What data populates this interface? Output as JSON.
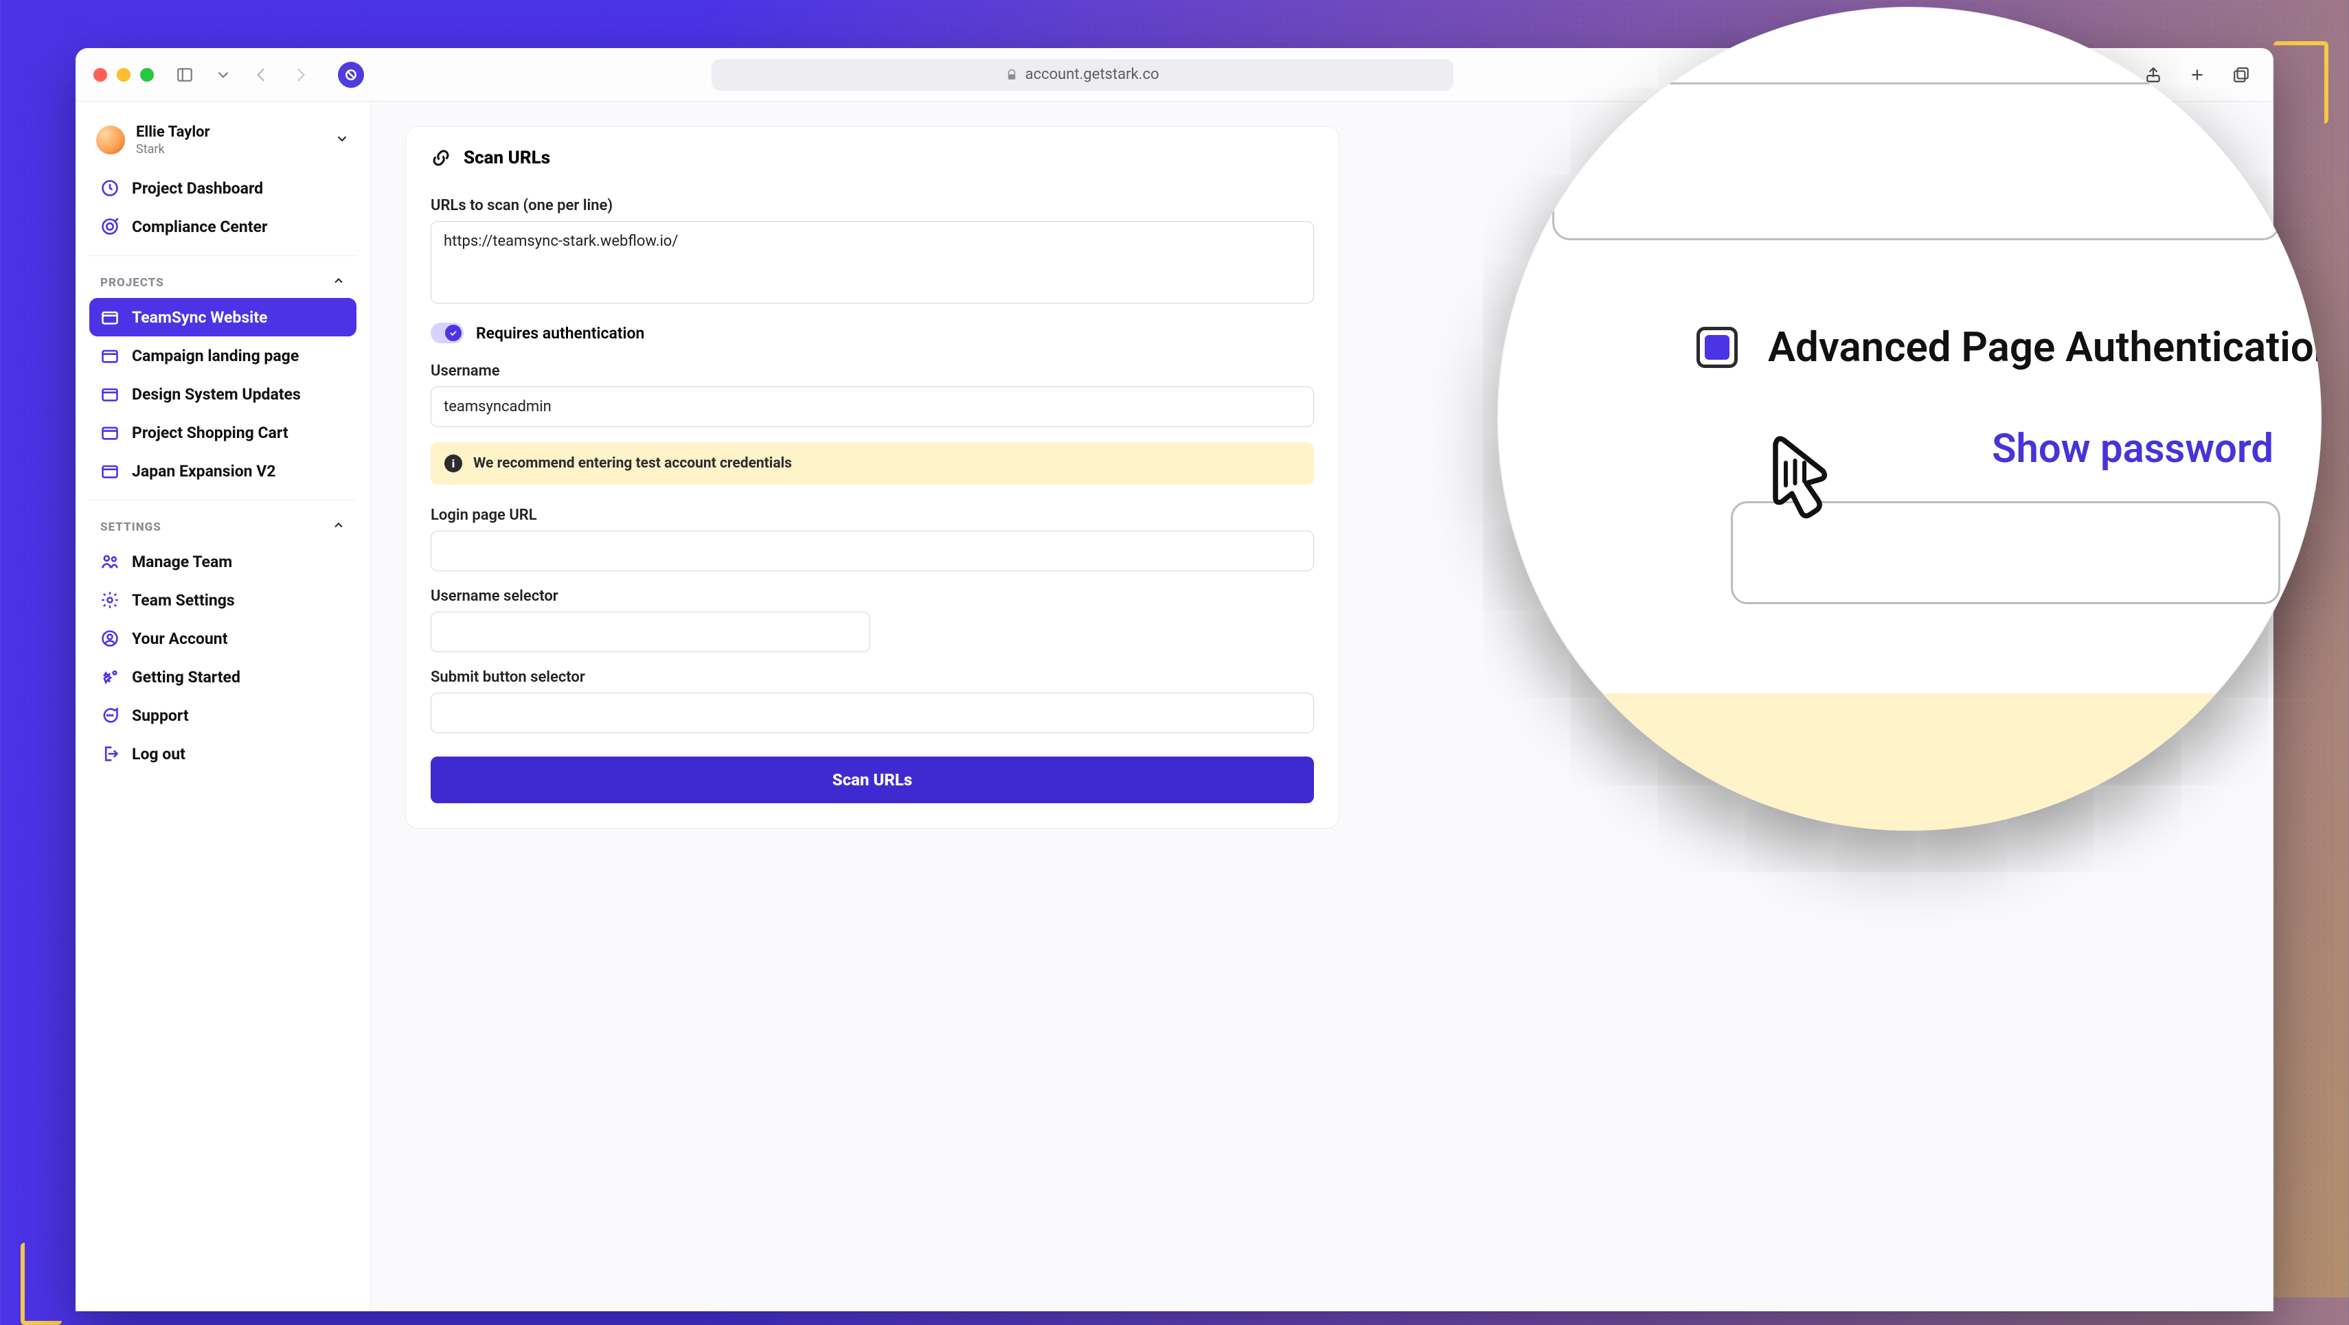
{
  "browser": {
    "url": "account.getstark.co"
  },
  "user": {
    "name": "Ellie Taylor",
    "org": "Stark"
  },
  "sidebar": {
    "top": [
      {
        "label": "Project Dashboard"
      },
      {
        "label": "Compliance Center"
      }
    ],
    "projects_header": "PROJECTS",
    "projects": [
      {
        "label": "TeamSync Website",
        "active": true
      },
      {
        "label": "Campaign landing page"
      },
      {
        "label": "Design System Updates"
      },
      {
        "label": "Project Shopping Cart"
      },
      {
        "label": "Japan Expansion V2"
      }
    ],
    "settings_header": "SETTINGS",
    "settings": [
      {
        "label": "Manage Team"
      },
      {
        "label": "Team Settings"
      },
      {
        "label": "Your Account"
      },
      {
        "label": "Getting Started"
      },
      {
        "label": "Support"
      },
      {
        "label": "Log out"
      }
    ]
  },
  "card": {
    "title": "Scan URLs",
    "urls_label": "URLs to scan (one per line)",
    "urls_value": "https://teamsync-stark.webflow.io/",
    "requires_auth_label": "Requires authentication",
    "username_label": "Username",
    "username_value": "teamsyncadmin",
    "info_banner": "We recommend entering test account credentials",
    "login_url_label": "Login page URL",
    "login_url_value": "",
    "username_selector_label": "Username selector",
    "username_selector_value": "",
    "submit_selector_label": "Submit button selector",
    "submit_selector_value": "",
    "scan_button": "Scan URLs"
  },
  "magnifier": {
    "auth_label": "Advanced Page Authentication",
    "show_password": "Show password"
  }
}
